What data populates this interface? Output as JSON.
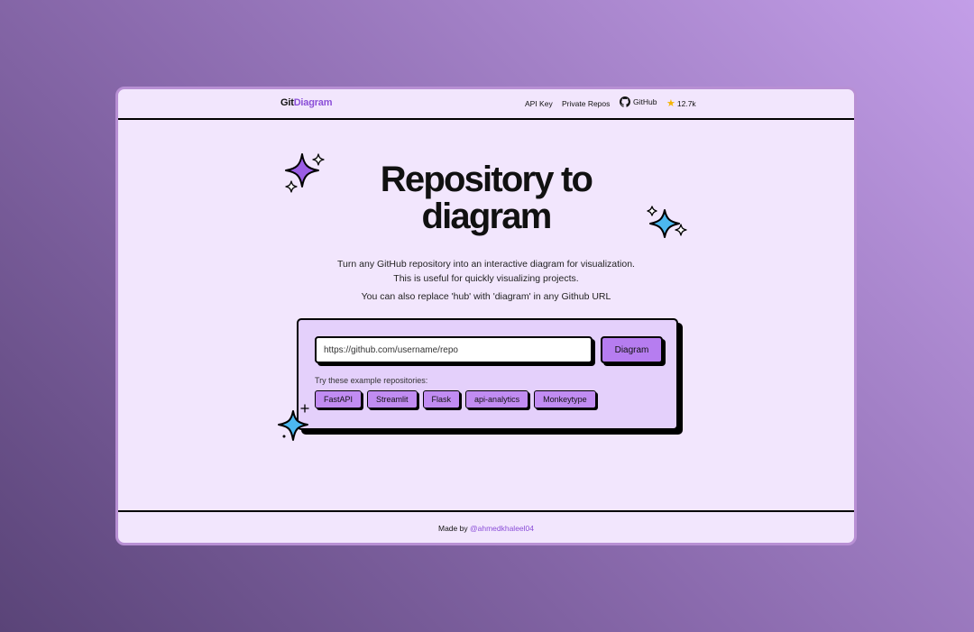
{
  "header": {
    "logo_part1": "Git",
    "logo_part2": "Diagram",
    "nav_api_key": "API Key",
    "nav_private_repos": "Private Repos",
    "nav_github": "GitHub",
    "star_count": "12.7k"
  },
  "hero": {
    "title_line1": "Repository to",
    "title_line2": "diagram",
    "subtitle_line1": "Turn any GitHub repository into an interactive diagram for visualization.",
    "subtitle_line2": "This is useful for quickly visualizing projects.",
    "subtitle_line3": "You can also replace 'hub' with 'diagram' in any Github URL"
  },
  "form": {
    "url_placeholder": "https://github.com/username/repo",
    "diagram_button": "Diagram",
    "examples_label": "Try these example repositories:",
    "examples": [
      "FastAPI",
      "Streamlit",
      "Flask",
      "api-analytics",
      "Monkeytype"
    ]
  },
  "footer": {
    "made_by": "Made by",
    "handle": "@ahmedkhaleel04"
  },
  "colors": {
    "accent": "#8b4fd8",
    "button": "#b67df0",
    "chip": "#c18cf2",
    "card": "#e4d0fb",
    "window_bg": "#f2e6fd",
    "sparkle_purple": "#9b5de5",
    "sparkle_blue": "#4cb8f0"
  },
  "icons": {
    "github": "github-icon",
    "star": "star-icon",
    "sparkles": "sparkle-icon"
  }
}
